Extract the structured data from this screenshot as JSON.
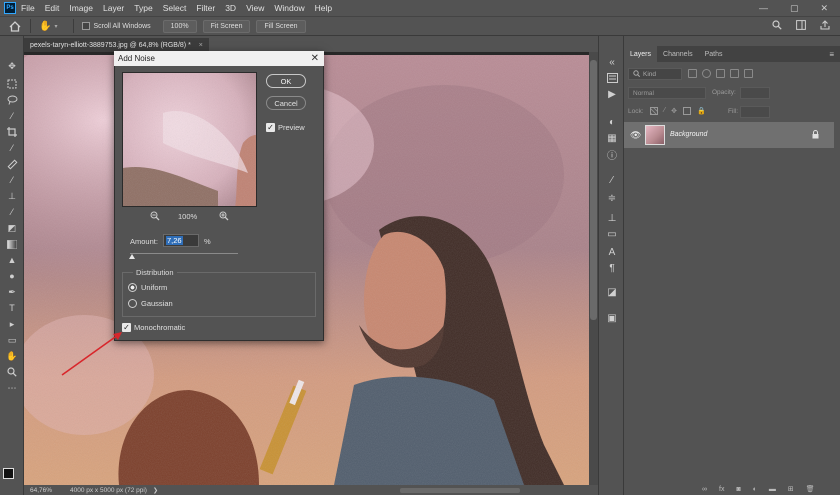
{
  "app": {
    "logo": "Ps"
  },
  "menu": [
    "File",
    "Edit",
    "Image",
    "Layer",
    "Type",
    "Select",
    "Filter",
    "3D",
    "View",
    "Window",
    "Help"
  ],
  "window_controls": {
    "minimize": "—",
    "maximize": "▢",
    "close": "✕"
  },
  "options_bar": {
    "scroll_all_windows": "Scroll All Windows",
    "zoom_100": "100%",
    "fit_screen": "Fit Screen",
    "fill_screen": "Fill Screen"
  },
  "document": {
    "tab_title": "pexels-taryn-elliott-3889753.jpg @ 64,8% (RGB/8) *",
    "close": "×"
  },
  "status": {
    "zoom": "64,76%",
    "info": "4000 px x 5000 px (72 ppi)"
  },
  "layers_panel": {
    "tabs": [
      "Layers",
      "Channels",
      "Paths"
    ],
    "menu_icon": "≡",
    "kind_placeholder": "Kind",
    "blend_mode": "Normal",
    "opacity_label": "Opacity:",
    "lock_label": "Lock:",
    "fill_label": "Fill:",
    "layer": {
      "name": "Background",
      "visible": true,
      "locked": true
    }
  },
  "dialog": {
    "title": "Add Noise",
    "close": "✕",
    "ok": "OK",
    "cancel": "Cancel",
    "preview_label": "Preview",
    "preview_checked": true,
    "zoom_level": "100%",
    "amount_label": "Amount:",
    "amount_value": "7,26",
    "amount_unit": "%",
    "amount_fraction": 0.018,
    "distribution_title": "Distribution",
    "distribution_options": [
      "Uniform",
      "Gaussian"
    ],
    "distribution_selected": "Uniform",
    "monochromatic_label": "Monochromatic",
    "monochromatic_checked": true
  },
  "colors": {
    "ui_bg": "#535353",
    "accent_blue": "#31a8ff",
    "selection_blue": "#2f6eb8",
    "annotation_arrow": "#d8262b"
  }
}
